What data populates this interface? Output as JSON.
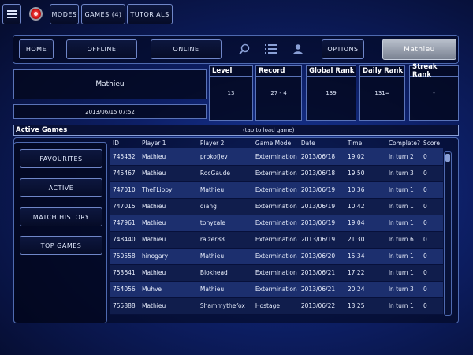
{
  "topbar": {
    "modes": "MODES",
    "games": "GAMES (4)",
    "tutorials": "TUTORIALS"
  },
  "nav": {
    "home": "HOME",
    "offline": "OFFLINE",
    "online": "ONLINE",
    "options": "OPTIONS",
    "user": "Mathieu"
  },
  "profile": {
    "name": "Mathieu",
    "datetime": "2013/06/15 07:52"
  },
  "stats": {
    "level_label": "Level",
    "level_value": "13",
    "record_label": "Record",
    "record_value": "27 - 4",
    "global_label": "Global Rank",
    "global_value": "139",
    "daily_label": "Daily Rank",
    "daily_value": "131=",
    "streak_label": "Streak Rank",
    "streak_value": "-"
  },
  "active_games": {
    "title": "Active Games",
    "hint": "(tap to load game)",
    "columns": [
      "ID",
      "Player 1",
      "Player 2",
      "Game Mode",
      "Date",
      "Time",
      "Complete?",
      "Score"
    ],
    "rows": [
      [
        "745432",
        "Mathieu",
        "prokofjev",
        "Extermination",
        "2013/06/18",
        "19:02",
        "In turn 2",
        "0"
      ],
      [
        "745467",
        "Mathieu",
        "RocGaude",
        "Extermination",
        "2013/06/18",
        "19:50",
        "In turn 3",
        "0"
      ],
      [
        "747010",
        "TheFLippy",
        "Mathieu",
        "Extermination",
        "2013/06/19",
        "10:36",
        "In turn 1",
        "0"
      ],
      [
        "747015",
        "Mathieu",
        "qiang",
        "Extermination",
        "2013/06/19",
        "10:42",
        "In turn 1",
        "0"
      ],
      [
        "747961",
        "Mathieu",
        "tonyzale",
        "Extermination",
        "2013/06/19",
        "19:04",
        "In turn 1",
        "0"
      ],
      [
        "748440",
        "Mathieu",
        "raizer88",
        "Extermination",
        "2013/06/19",
        "21:30",
        "In turn 6",
        "0"
      ],
      [
        "750558",
        "hinogary",
        "Mathieu",
        "Extermination",
        "2013/06/20",
        "15:34",
        "In turn 1",
        "0"
      ],
      [
        "753641",
        "Mathieu",
        "Blokhead",
        "Extermination",
        "2013/06/21",
        "17:22",
        "In turn 1",
        "0"
      ],
      [
        "754056",
        "Muhve",
        "Mathieu",
        "Extermination",
        "2013/06/21",
        "20:24",
        "In turn 3",
        "0"
      ],
      [
        "755888",
        "Mathieu",
        "Shammythefox",
        "Hostage",
        "2013/06/22",
        "13:25",
        "In turn 1",
        "0"
      ]
    ]
  },
  "sidebar": {
    "favourites": "FAVOURITES",
    "active": "ACTIVE",
    "match_history": "MATCH HISTORY",
    "top_games": "TOP GAMES"
  },
  "colors": {
    "accent": "#5a73b8",
    "row_light": "#1c2f6e",
    "row_dark": "#101d4c"
  }
}
